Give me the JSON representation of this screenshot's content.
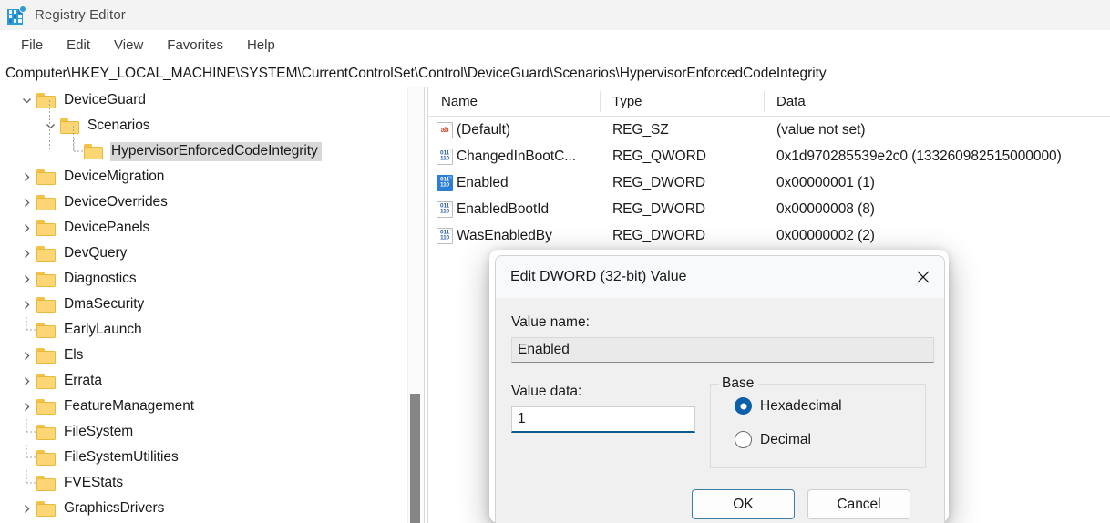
{
  "window": {
    "title": "Registry Editor",
    "icon": "registry-editor-icon"
  },
  "menubar": {
    "items": [
      {
        "label": "File"
      },
      {
        "label": "Edit"
      },
      {
        "label": "View"
      },
      {
        "label": "Favorites"
      },
      {
        "label": "Help"
      }
    ]
  },
  "address": {
    "path": "Computer\\HKEY_LOCAL_MACHINE\\SYSTEM\\CurrentControlSet\\Control\\DeviceGuard\\Scenarios\\HypervisorEnforcedCodeIntegrity"
  },
  "tree": {
    "items": [
      {
        "label": "DeviceGuard",
        "depth": 1,
        "expander": "expanded",
        "selected": false
      },
      {
        "label": "Scenarios",
        "depth": 2,
        "expander": "expanded",
        "selected": false
      },
      {
        "label": "HypervisorEnforcedCodeIntegrity",
        "depth": 3,
        "expander": "none",
        "selected": true
      },
      {
        "label": "DeviceMigration",
        "depth": 1,
        "expander": "collapsed",
        "selected": false
      },
      {
        "label": "DeviceOverrides",
        "depth": 1,
        "expander": "collapsed",
        "selected": false
      },
      {
        "label": "DevicePanels",
        "depth": 1,
        "expander": "collapsed",
        "selected": false
      },
      {
        "label": "DevQuery",
        "depth": 1,
        "expander": "collapsed",
        "selected": false
      },
      {
        "label": "Diagnostics",
        "depth": 1,
        "expander": "collapsed",
        "selected": false
      },
      {
        "label": "DmaSecurity",
        "depth": 1,
        "expander": "collapsed",
        "selected": false
      },
      {
        "label": "EarlyLaunch",
        "depth": 1,
        "expander": "none",
        "selected": false
      },
      {
        "label": "Els",
        "depth": 1,
        "expander": "collapsed",
        "selected": false
      },
      {
        "label": "Errata",
        "depth": 1,
        "expander": "collapsed",
        "selected": false
      },
      {
        "label": "FeatureManagement",
        "depth": 1,
        "expander": "collapsed",
        "selected": false
      },
      {
        "label": "FileSystem",
        "depth": 1,
        "expander": "none",
        "selected": false
      },
      {
        "label": "FileSystemUtilities",
        "depth": 1,
        "expander": "none",
        "selected": false
      },
      {
        "label": "FVEStats",
        "depth": 1,
        "expander": "none",
        "selected": false
      },
      {
        "label": "GraphicsDrivers",
        "depth": 1,
        "expander": "collapsed",
        "selected": false
      }
    ]
  },
  "values": {
    "columns": [
      "Name",
      "Type",
      "Data"
    ],
    "rows": [
      {
        "name": "(Default)",
        "type": "REG_SZ",
        "data": "(value not set)",
        "icon": "string-value-icon",
        "selected": false
      },
      {
        "name": "ChangedInBootC...",
        "type": "REG_QWORD",
        "data": "0x1d970285539e2c0 (133260982515000000)",
        "icon": "binary-value-icon",
        "selected": false
      },
      {
        "name": "Enabled",
        "type": "REG_DWORD",
        "data": "0x00000001 (1)",
        "icon": "binary-value-icon",
        "selected": true
      },
      {
        "name": "EnabledBootId",
        "type": "REG_DWORD",
        "data": "0x00000008 (8)",
        "icon": "binary-value-icon",
        "selected": false
      },
      {
        "name": "WasEnabledBy",
        "type": "REG_DWORD",
        "data": "0x00000002 (2)",
        "icon": "binary-value-icon",
        "selected": false
      }
    ]
  },
  "dialog": {
    "title": "Edit DWORD (32-bit) Value",
    "close_icon": "close-icon",
    "value_name_label": "Value name:",
    "value_name": "Enabled",
    "value_data_label": "Value data:",
    "value_data": "1",
    "base_legend": "Base",
    "base_options": [
      {
        "label": "Hexadecimal",
        "checked": true
      },
      {
        "label": "Decimal",
        "checked": false
      }
    ],
    "ok_label": "OK",
    "cancel_label": "Cancel"
  },
  "colors": {
    "accent": "#0b5fa8",
    "selection": "#2a7fd4",
    "folder": "#fcd675",
    "titlebar": "#f3f3f3"
  }
}
